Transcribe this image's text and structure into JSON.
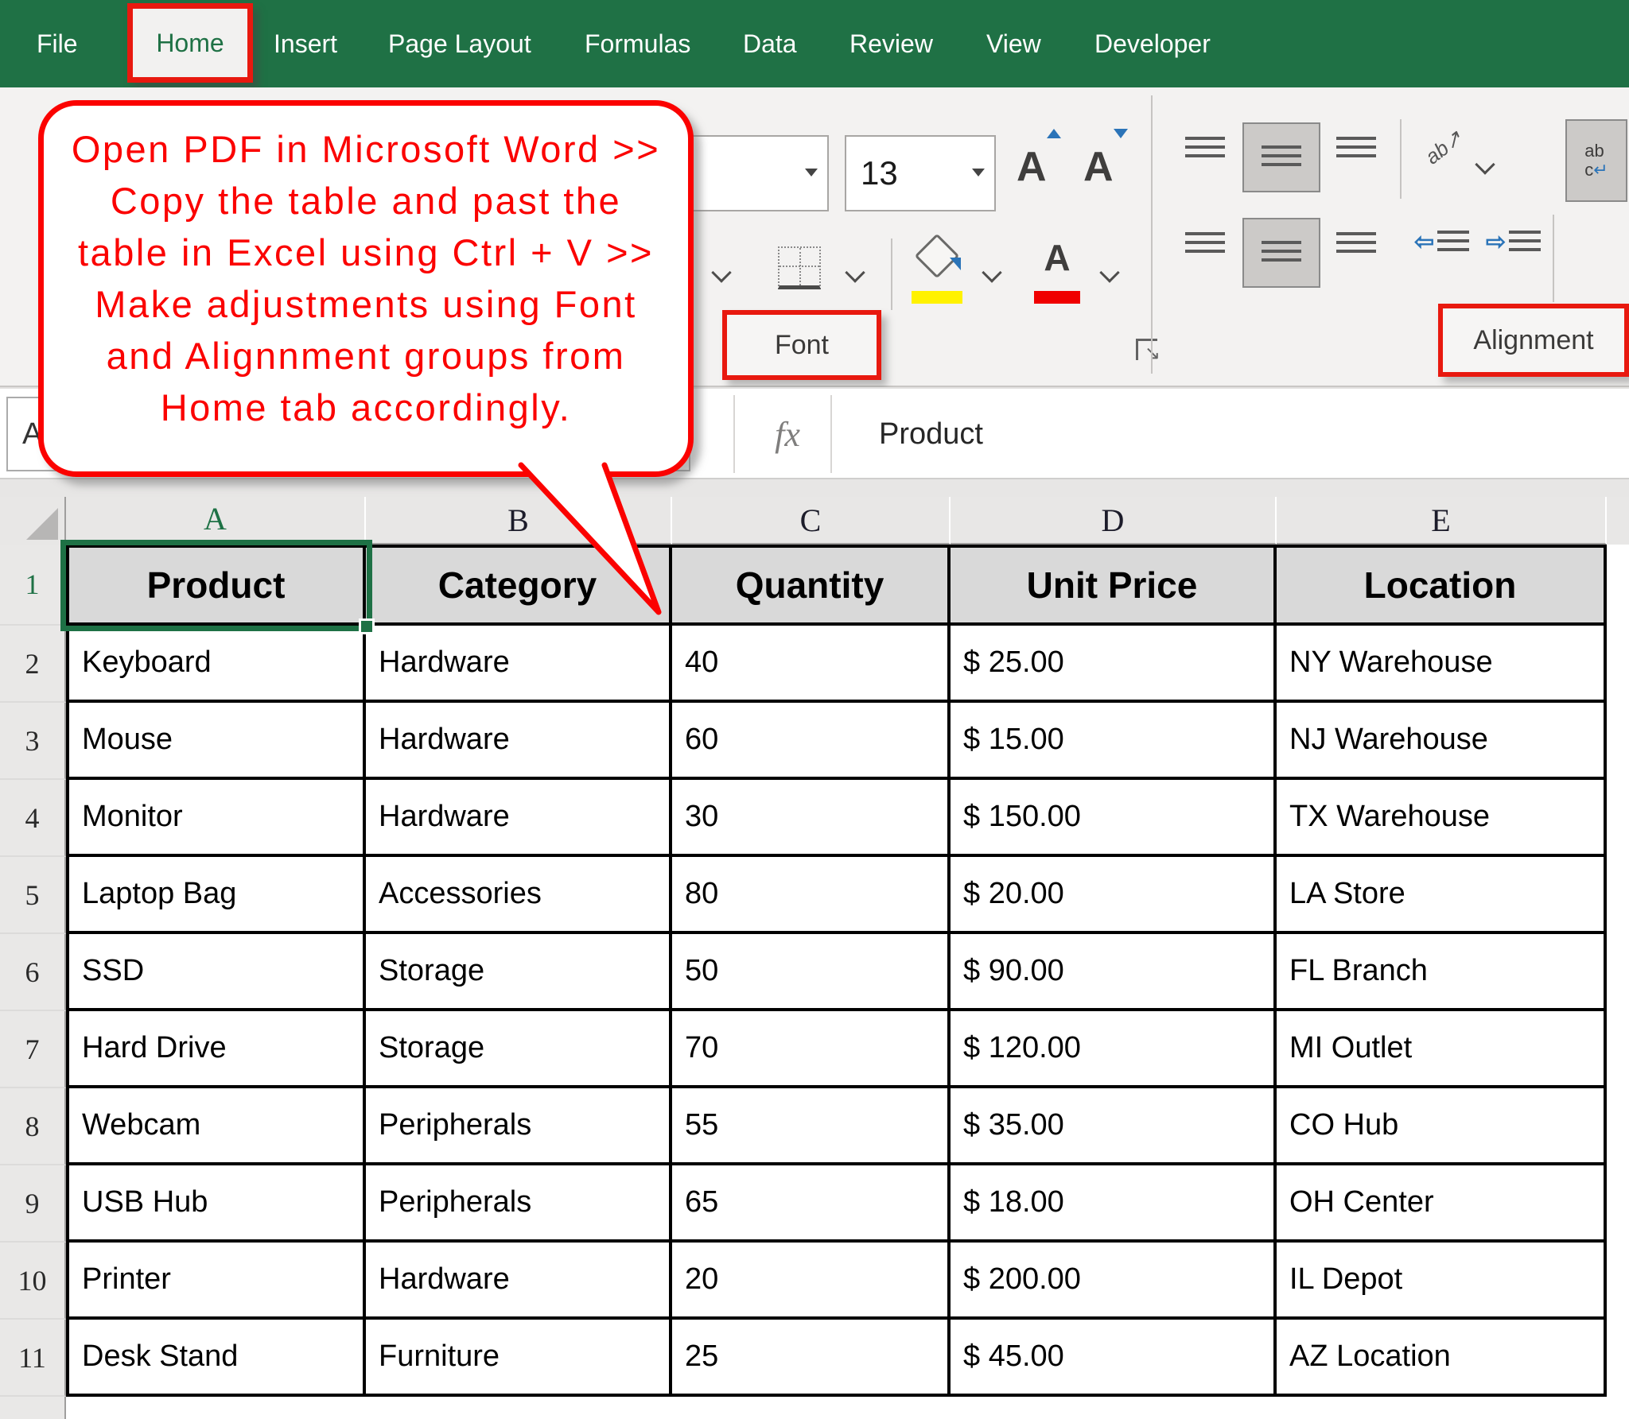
{
  "menubar": {
    "items": [
      {
        "label": "File",
        "active": false
      },
      {
        "label": "Home",
        "active": true
      },
      {
        "label": "Insert",
        "active": false
      },
      {
        "label": "Page Layout",
        "active": false
      },
      {
        "label": "Formulas",
        "active": false
      },
      {
        "label": "Data",
        "active": false
      },
      {
        "label": "Review",
        "active": false
      },
      {
        "label": "View",
        "active": false
      },
      {
        "label": "Developer",
        "active": false
      }
    ]
  },
  "ribbon": {
    "font_size_value": "13",
    "font_group_label": "Font",
    "alignment_group_label": "Alignment",
    "wrap_text_icon_text_line1": "ab",
    "wrap_text_icon_text_line2": "c",
    "orientation_icon_text": "ab",
    "colors": {
      "excel_green": "#1f7145",
      "fill_color_swatch": "#fff200",
      "font_color_swatch": "#f00000",
      "accent_blue": "#2b74b8",
      "annotation_red": "#fb0200"
    }
  },
  "formula_bar": {
    "name_box_value": "A",
    "fx_label": "fx",
    "value": "Product"
  },
  "callout": {
    "lines": [
      "Open PDF in Microsoft Word >>",
      "Copy the table and past the",
      "table in Excel using Ctrl + V >>",
      "Make adjustments using Font",
      "and Alignnment groups from",
      "Home tab accordingly."
    ]
  },
  "sheet": {
    "column_letters": [
      "A",
      "B",
      "C",
      "D",
      "E"
    ],
    "row_numbers": [
      "1",
      "2",
      "3",
      "4",
      "5",
      "6",
      "7",
      "8",
      "9",
      "10",
      "11"
    ],
    "selected_cell": "A1",
    "table": {
      "headers": [
        "Product",
        "Category",
        "Quantity",
        "Unit Price",
        "Location"
      ],
      "rows": [
        [
          "Keyboard",
          "Hardware",
          "40",
          "$ 25.00",
          "NY Warehouse"
        ],
        [
          "Mouse",
          "Hardware",
          "60",
          "$ 15.00",
          "NJ Warehouse"
        ],
        [
          "Monitor",
          "Hardware",
          "30",
          "$ 150.00",
          "TX Warehouse"
        ],
        [
          "Laptop Bag",
          "Accessories",
          "80",
          "$ 20.00",
          "LA Store"
        ],
        [
          "SSD",
          "Storage",
          "50",
          "$ 90.00",
          "FL Branch"
        ],
        [
          "Hard Drive",
          "Storage",
          "70",
          "$ 120.00",
          "MI Outlet"
        ],
        [
          "Webcam",
          "Peripherals",
          "55",
          "$ 35.00",
          "CO Hub"
        ],
        [
          "USB Hub",
          "Peripherals",
          "65",
          "$ 18.00",
          "OH Center"
        ],
        [
          "Printer",
          "Hardware",
          "20",
          "$ 200.00",
          "IL Depot"
        ],
        [
          "Desk Stand",
          "Furniture",
          "25",
          "$ 45.00",
          "AZ Location"
        ]
      ]
    }
  }
}
